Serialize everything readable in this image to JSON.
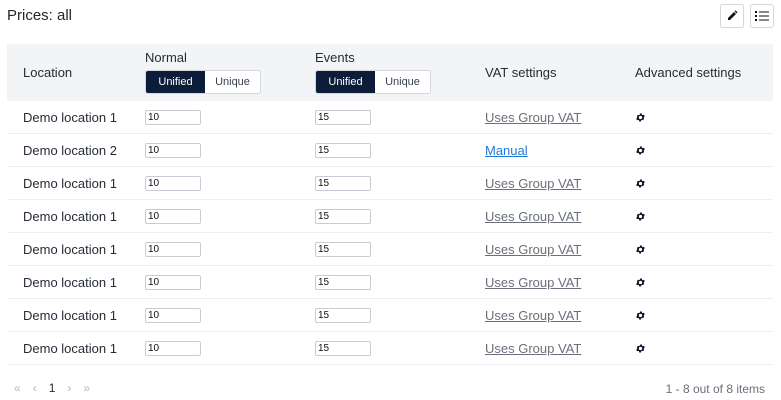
{
  "header": {
    "title": "Prices: all",
    "edit_icon": "pencil-icon",
    "list_icon": "list-icon"
  },
  "table": {
    "columns": {
      "location": "Location",
      "normal": "Normal",
      "events": "Events",
      "vat": "VAT settings",
      "advanced": "Advanced settings"
    },
    "toggle": {
      "unified": "Unified",
      "unique": "Unique",
      "selected": "Unified"
    },
    "rows": [
      {
        "location": "Demo location 1",
        "normal": "10",
        "events": "15",
        "vat": "Uses Group VAT"
      },
      {
        "location": "Demo location 2",
        "normal": "10",
        "events": "15",
        "vat": "Manual"
      },
      {
        "location": "Demo location 1",
        "normal": "10",
        "events": "15",
        "vat": "Uses Group VAT"
      },
      {
        "location": "Demo location 1",
        "normal": "10",
        "events": "15",
        "vat": "Uses Group VAT"
      },
      {
        "location": "Demo location 1",
        "normal": "10",
        "events": "15",
        "vat": "Uses Group VAT"
      },
      {
        "location": "Demo location 1",
        "normal": "10",
        "events": "15",
        "vat": "Uses Group VAT"
      },
      {
        "location": "Demo location 1",
        "normal": "10",
        "events": "15",
        "vat": "Uses Group VAT"
      },
      {
        "location": "Demo location 1",
        "normal": "10",
        "events": "15",
        "vat": "Uses Group VAT"
      }
    ]
  },
  "pagination": {
    "current_page": "1",
    "items_info": "1 - 8 out of 8 items"
  },
  "colors": {
    "accent_dark": "#0c1d3a",
    "link_blue": "#1e7ad6",
    "link_gray": "#6a6f7b"
  }
}
